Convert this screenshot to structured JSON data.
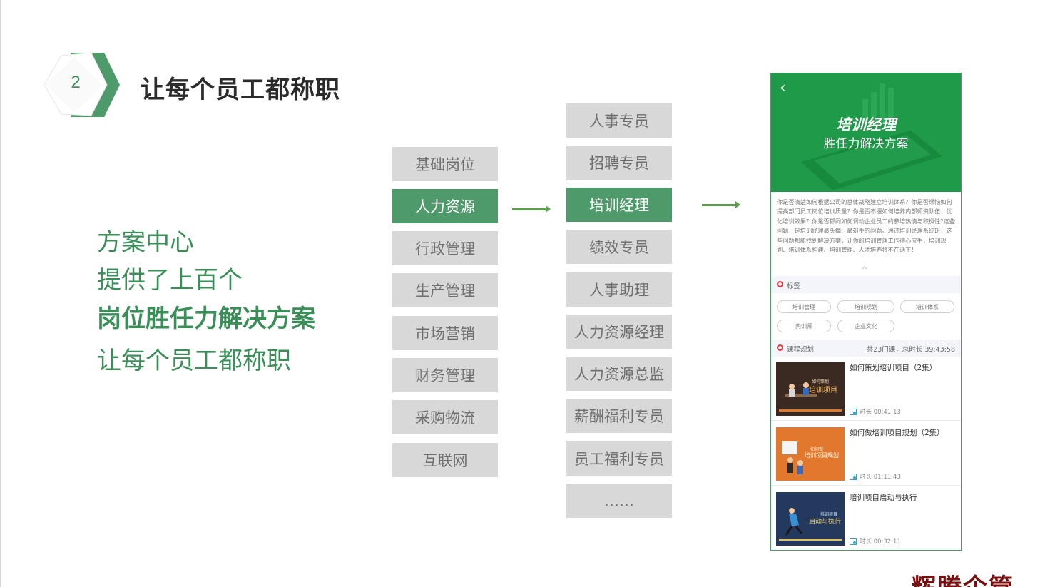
{
  "header": {
    "step_number": "2",
    "title": "让每个员工都称职"
  },
  "promo": {
    "line1": "方案中心",
    "line2": "提供了上百个",
    "line3": "岗位胜任力解决方案",
    "line4": "让每个员工都称职"
  },
  "categories": [
    "基础岗位",
    "人力资源",
    "行政管理",
    "生产管理",
    "市场营销",
    "财务管理",
    "采购物流",
    "互联网"
  ],
  "roles": [
    "人事专员",
    "招聘专员",
    "培训经理",
    "绩效专员",
    "人事助理",
    "人力资源经理",
    "人力资源总监",
    "薪酬福利专员",
    "员工福利专员",
    "……"
  ],
  "phone": {
    "hero_title": "培训经理",
    "hero_subtitle": "胜任力解决方案",
    "description": "你是否清楚如何根据公司的总体战略建立培训体系？你是否烦恼如何提高部门员工岗位培训质量？你是否不擅如何培养内部师资队伍、优化培训效果？你是否郁闷如何调动企业员工的参培热情与积极性?这些问题，是培训经理最头痛、最剃手的问题。通过培训经理系统班，这些问题都能找到解决方案，让你的培训管理工作得心应手，培训规划、培训体系构建、培训管理、人才培养将不在话下！",
    "tags_label": "标签",
    "tags": [
      "培训管理",
      "培训规划",
      "培训体系",
      "内训师",
      "企业文化"
    ],
    "plan_label": "课程规划",
    "plan_summary": "共23门课，总时长 39:43:58",
    "courses": [
      {
        "title": "如何策划培训项目（2集）",
        "duration": "时长 00:41:13",
        "thumb_small": "如何策划",
        "thumb_big": "培训项目"
      },
      {
        "title": "如何做培训项目规划（2集）",
        "duration": "时长 01:11:43",
        "thumb_small": "如何做",
        "thumb_big": "培训项目规划"
      },
      {
        "title": "培训项目启动与执行",
        "duration": "时长 00:32:11",
        "thumb_small": "培训项目",
        "thumb_big": "启动与执行"
      }
    ]
  },
  "watermark": "辉腾企管",
  "colors": {
    "accent_green": "#4f9a6a",
    "hero_green": "#1f9a48",
    "text_green": "#3a8f58",
    "arrow_green": "#5aa04a"
  }
}
